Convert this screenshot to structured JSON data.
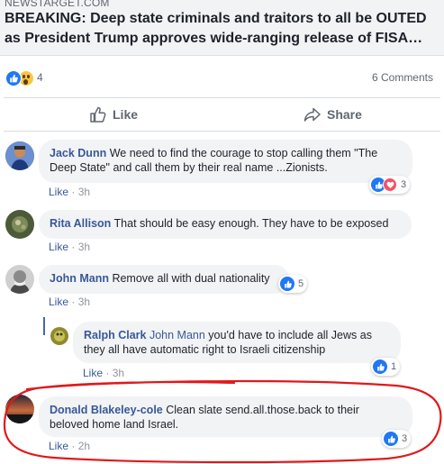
{
  "link_preview": {
    "source": "NEWSTARGET.COM",
    "title": "BREAKING: Deep state criminals and traitors to all be OUTED as President Trump approves wide-ranging release of FISA…"
  },
  "reactions_bar": {
    "icons": [
      "like-icon",
      "wow-icon"
    ],
    "reaction_count": "4",
    "comments_count": "6 Comments"
  },
  "actions": {
    "like_label": "Like",
    "share_label": "Share"
  },
  "comments": [
    {
      "author": "Jack Dunn",
      "text": "We need to find the courage to stop calling them \"The Deep State\" and call them by their real name ...Zionists.",
      "like_label": "Like",
      "separator": " · ",
      "time": "3h",
      "reaction_count": "3",
      "reaction_icons": [
        "like-icon",
        "love-icon"
      ]
    },
    {
      "author": "Rita Allison",
      "text": "That should be easy enough. They have to be exposed",
      "like_label": "Like",
      "separator": " · ",
      "time": "3h"
    },
    {
      "author": "John Mann",
      "text": "Remove all with dual nationality",
      "like_label": "Like",
      "separator": " · ",
      "time": "3h",
      "reaction_count": "5",
      "reaction_icons": [
        "like-icon"
      ]
    },
    {
      "author": "Ralph Clark",
      "mention": "John Mann",
      "text": "you'd have to include all Jews as they all have automatic right to Israeli citizenship",
      "like_label": "Like",
      "separator": " · ",
      "time": "3h",
      "reaction_count": "1",
      "reaction_icons": [
        "like-icon"
      ]
    },
    {
      "author": "Donald Blakeley-cole",
      "text": "Clean slate send.all.those.back to their beloved home land Israel.",
      "like_label": "Like",
      "separator": " · ",
      "time": "2h",
      "reaction_count": "3",
      "reaction_icons": [
        "like-icon"
      ]
    }
  ],
  "colors": {
    "link_blue": "#385898",
    "like_blue": "#2078f4",
    "love_red": "#f25268",
    "bubble_grey": "#f2f3f5",
    "annotation_red": "#e0191b"
  }
}
